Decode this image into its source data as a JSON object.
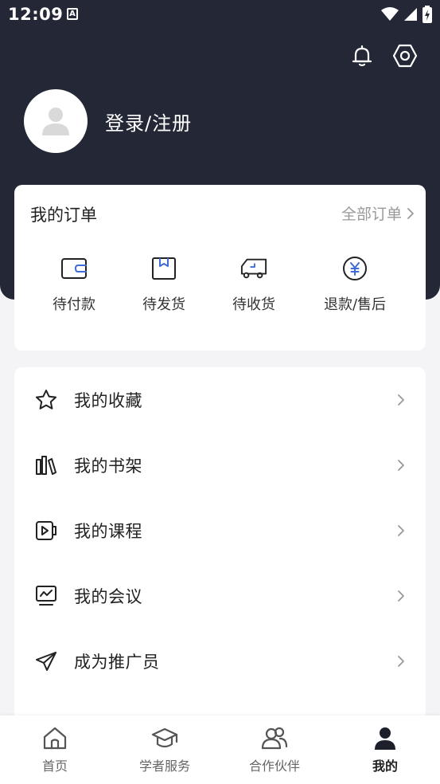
{
  "status_bar": {
    "time": "12:09",
    "notification_letter": "A"
  },
  "header": {
    "login_label": "登录/注册"
  },
  "orders": {
    "title": "我的订单",
    "all_label": "全部订单",
    "items": [
      {
        "label": "待付款",
        "icon": "wallet-icon"
      },
      {
        "label": "待发货",
        "icon": "package-icon"
      },
      {
        "label": "待收货",
        "icon": "truck-icon"
      },
      {
        "label": "退款/售后",
        "icon": "yen-circle-icon"
      }
    ]
  },
  "menu": {
    "items": [
      {
        "label": "我的收藏",
        "icon": "star-icon"
      },
      {
        "label": "我的书架",
        "icon": "bookshelf-icon"
      },
      {
        "label": "我的课程",
        "icon": "video-course-icon"
      },
      {
        "label": "我的会议",
        "icon": "meeting-board-icon"
      },
      {
        "label": "成为推广员",
        "icon": "paper-plane-icon"
      }
    ]
  },
  "tabbar": {
    "active_index": 3,
    "items": [
      {
        "label": "首页",
        "icon": "home-icon"
      },
      {
        "label": "学者服务",
        "icon": "graduation-cap-icon"
      },
      {
        "label": "合作伙伴",
        "icon": "partners-icon"
      },
      {
        "label": "我的",
        "icon": "user-icon"
      }
    ]
  },
  "colors": {
    "header_bg": "#242836",
    "accent_blue": "#3f6bd6",
    "text_dark": "#222222",
    "text_muted": "#999999"
  }
}
